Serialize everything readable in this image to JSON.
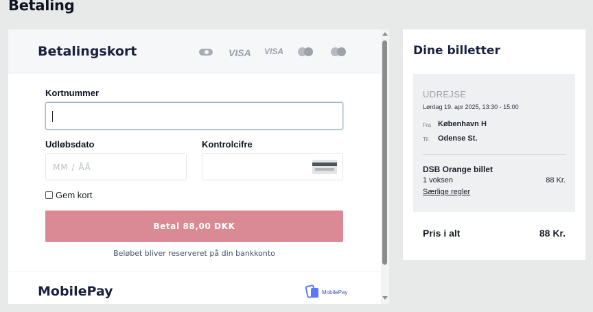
{
  "colors": {
    "page_bg": "#e8eaea",
    "pay_button": "#d98a94",
    "link": "#3d4e66",
    "mobilepay_blue": "#5a78ff"
  },
  "page": {
    "title": "Betaling"
  },
  "card_section": {
    "title": "Betalingskort",
    "brands": [
      "dankort-icon",
      "VISA",
      "VISA",
      "mastercard-icon",
      "maestro-icon"
    ],
    "visa_label": "VISA",
    "card_number": {
      "label": "Kortnummer",
      "value": "",
      "placeholder": ""
    },
    "expiry": {
      "label": "Udløbsdato",
      "placeholder": "MM / ÅÅ"
    },
    "cvc": {
      "label": "Kontrolcifre",
      "placeholder": ""
    },
    "save_card": {
      "label": "Gem kort",
      "checked": false
    },
    "pay_button": "Betal 88,00 DKK",
    "reserve_note": "Beløbet bliver reserveret på din bankkonto"
  },
  "mobilepay": {
    "title": "MobilePay",
    "logo_text": "MobilePay"
  },
  "tickets": {
    "title": "Dine billetter",
    "direction": "UDREJSE",
    "datetime": "Lørdag 19. apr 2025, 13:30 - 15:00",
    "from": {
      "label": "Fra",
      "value": "København H"
    },
    "to": {
      "label": "Til",
      "value": "Odense St."
    },
    "ticket_name": "DSB Orange billet",
    "quantity": "1 voksen",
    "price": "88 Kr.",
    "rules_link": "Særlige regler",
    "total_label": "Pris i alt",
    "total_value": "88 Kr."
  }
}
